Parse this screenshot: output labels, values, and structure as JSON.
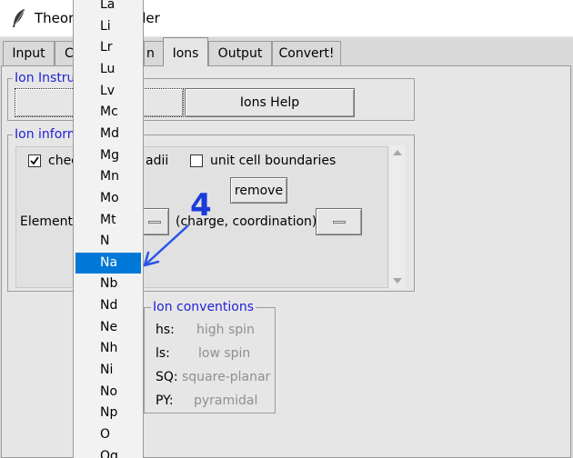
{
  "window": {
    "title": "Theory Ion Builder"
  },
  "tabs": [
    {
      "label": "Input"
    },
    {
      "label": "C"
    },
    {
      "label": "n"
    },
    {
      "label": "Ions"
    },
    {
      "label": "Output"
    },
    {
      "label": "Convert!"
    }
  ],
  "ion_instructions": {
    "title": "Ion Instru",
    "help_button": "Ions Help"
  },
  "ion_information": {
    "title": "Ion inform",
    "check_label_a": "chec",
    "check_label_b": "adii",
    "check_checked": true,
    "unit_cell_label": "unit cell boundaries",
    "unit_cell_checked": false,
    "remove_button": "remove",
    "element_label": "Element",
    "charge_label": "(charge, coordination)"
  },
  "ion_conventions": {
    "title": "Ion conventions",
    "rows": [
      {
        "key": "hs:",
        "value": "high spin"
      },
      {
        "key": "ls:",
        "value": "low spin"
      },
      {
        "key": "SQ:",
        "value": "square-planar"
      },
      {
        "key": "PY:",
        "value": "pyramidal"
      }
    ]
  },
  "element_dropdown": {
    "items": [
      "La",
      "Li",
      "Lr",
      "Lu",
      "Lv",
      "Mc",
      "Md",
      "Mg",
      "Mn",
      "Mo",
      "Mt",
      "N",
      "Na",
      "Nb",
      "Nd",
      "Ne",
      "Nh",
      "Ni",
      "No",
      "Np",
      "O",
      "Og"
    ],
    "selected": "Na"
  },
  "annotation": {
    "label": "4",
    "color": "#1a3bd9"
  },
  "colors": {
    "accent": "#0078d7",
    "group_title": "#1f1fd6"
  }
}
